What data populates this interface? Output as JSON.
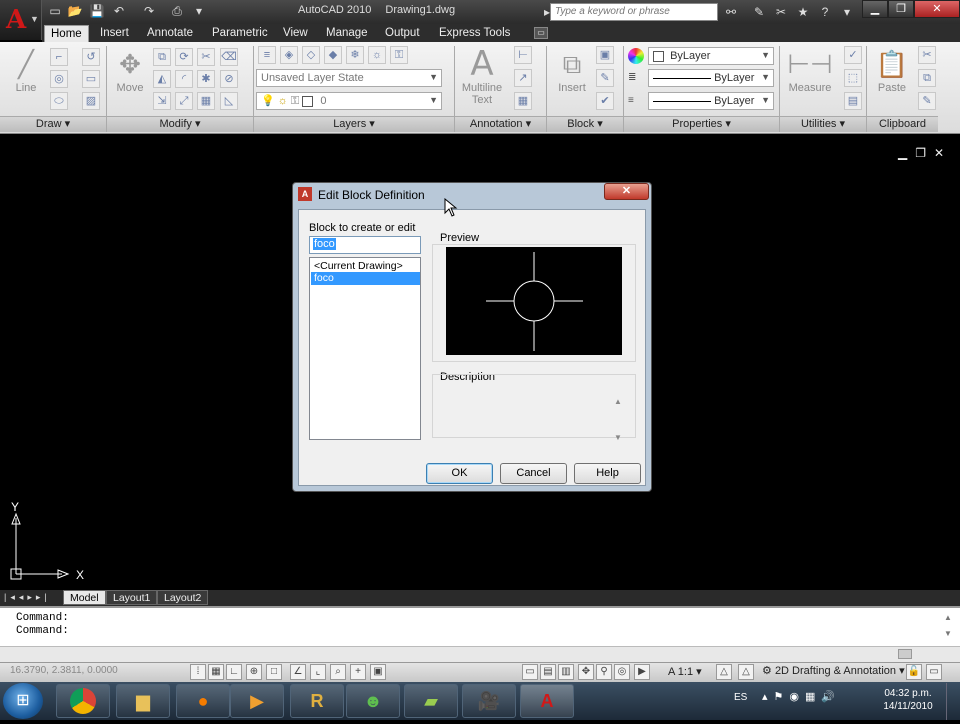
{
  "app": {
    "title": "AutoCAD 2010",
    "filename": "Drawing1.dwg"
  },
  "search": {
    "placeholder": "Type a keyword or phrase"
  },
  "ribbon": {
    "tabs": [
      "Home",
      "Insert",
      "Annotate",
      "Parametric",
      "View",
      "Manage",
      "Output",
      "Express Tools"
    ],
    "active_tab": "Home",
    "panels": [
      "Draw",
      "Modify",
      "Layers",
      "Annotation",
      "Block",
      "Properties",
      "Utilities",
      "Clipboard"
    ],
    "draw": {
      "line": "Line"
    },
    "modify": {
      "move": "Move"
    },
    "layers": {
      "state": "Unsaved Layer State",
      "current": "0"
    },
    "annotation": {
      "multiline_text": "Multiline\nText",
      "multiline_line1": "Multiline",
      "multiline_line2": "Text"
    },
    "block": {
      "insert": "Insert"
    },
    "properties": {
      "color": "ByLayer",
      "linetype": "ByLayer",
      "lineweight": "ByLayer"
    },
    "utilities": {
      "measure": "Measure"
    },
    "clipboard": {
      "paste": "Paste"
    }
  },
  "dialog": {
    "title": "Edit Block Definition",
    "block_label": "Block to create or edit",
    "block_value": "foco",
    "list": [
      "<Current Drawing>",
      "foco"
    ],
    "selected_index": 1,
    "preview_label": "Preview",
    "description_label": "Description",
    "ok": "OK",
    "cancel": "Cancel",
    "help": "Help"
  },
  "ucs": {
    "x": "X",
    "y": "Y"
  },
  "layout_tabs": [
    "Model",
    "Layout1",
    "Layout2"
  ],
  "command_lines": [
    "Command:",
    "Command:"
  ],
  "status": {
    "coords": "16.3790, 2.3811, 0.0000",
    "scale": "A 1:1",
    "workspace": "2D Drafting & Annotation"
  },
  "tray": {
    "lang": "ES",
    "time": "04:32 p.m.",
    "date": "14/11/2010"
  },
  "colors": {
    "app_red": "#d01818",
    "selection": "#3399ff",
    "ribbon_bg": "#e9e9e9"
  }
}
